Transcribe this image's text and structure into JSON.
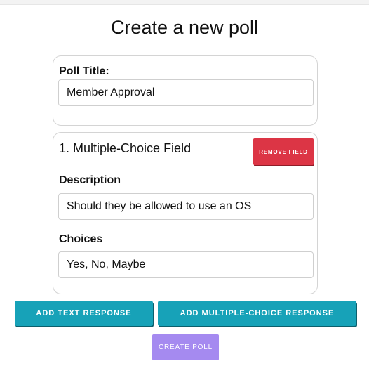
{
  "page": {
    "title": "Create a new poll"
  },
  "poll_title_card": {
    "label": "Poll Title:",
    "value": "Member Approval"
  },
  "fields": [
    {
      "heading": "1. Multiple-Choice Field",
      "remove_label": "REMOVE FIELD",
      "description_label": "Description",
      "description_value": "Should they be allowed to use an OS",
      "choices_label": "Choices",
      "choices_value": "Yes, No, Maybe"
    }
  ],
  "actions": {
    "add_text_label": "ADD TEXT RESPONSE",
    "add_mc_label": "ADD MULTIPLE-CHOICE RESPONSE",
    "create_label": "CREATE POLL"
  },
  "colors": {
    "remove": "#dc3545",
    "action": "#17a2b8",
    "create": "#a58af0"
  }
}
